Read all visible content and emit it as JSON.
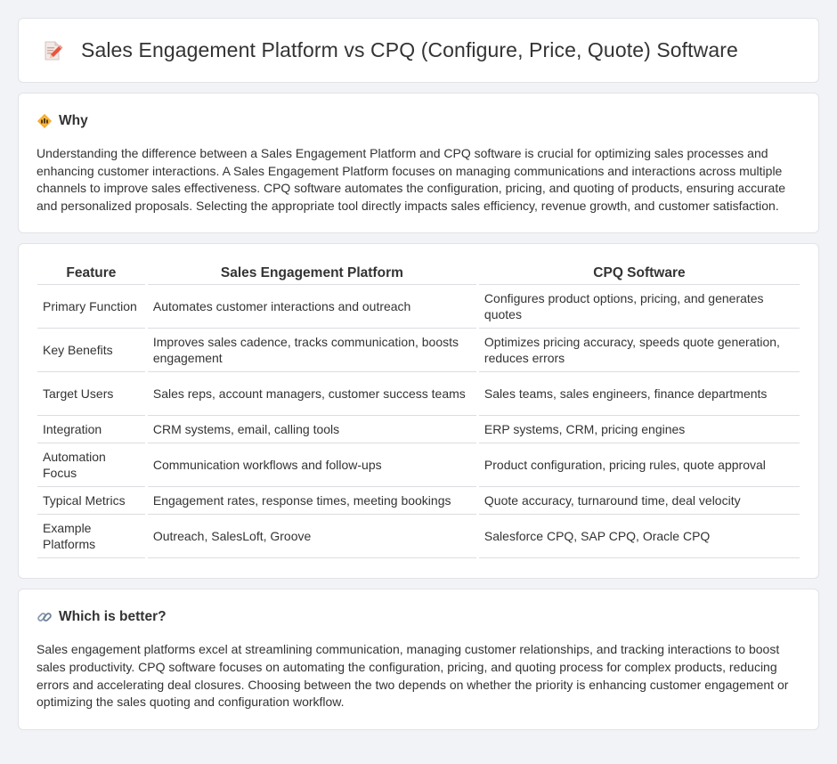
{
  "page": {
    "title": "Sales Engagement Platform vs CPQ (Configure, Price, Quote) Software"
  },
  "why": {
    "heading": "Why",
    "body": "Understanding the difference between a Sales Engagement Platform and CPQ software is crucial for optimizing sales processes and enhancing customer interactions. A Sales Engagement Platform focuses on managing communications and interactions across multiple channels to improve sales effectiveness. CPQ software automates the configuration, pricing, and quoting of products, ensuring accurate and personalized proposals. Selecting the appropriate tool directly impacts sales efficiency, revenue growth, and customer satisfaction."
  },
  "table": {
    "headers": [
      "Feature",
      "Sales Engagement Platform",
      "CPQ Software"
    ],
    "rows": [
      [
        "Primary Function",
        "Automates customer interactions and outreach",
        "Configures product options, pricing, and generates quotes"
      ],
      [
        "Key Benefits",
        "Improves sales cadence, tracks communication, boosts engagement",
        "Optimizes pricing accuracy, speeds quote generation, reduces errors"
      ],
      [
        "Target Users",
        "Sales reps, account managers, customer success teams",
        "Sales teams, sales engineers, finance departments"
      ],
      [
        "Integration",
        "CRM systems, email, calling tools",
        "ERP systems, CRM, pricing engines"
      ],
      [
        "Automation Focus",
        "Communication workflows and follow-ups",
        "Product configuration, pricing rules, quote approval"
      ],
      [
        "Typical Metrics",
        "Engagement rates, response times, meeting bookings",
        "Quote accuracy, turnaround time, deal velocity"
      ],
      [
        "Example Platforms",
        "Outreach, SalesLoft, Groove",
        "Salesforce CPQ, SAP CPQ, Oracle CPQ"
      ]
    ]
  },
  "better": {
    "heading": "Which is better?",
    "body": "Sales engagement platforms excel at streamlining communication, managing customer relationships, and tracking interactions to boost sales productivity. CPQ software focuses on automating the configuration, pricing, and quoting process for complex products, reducing errors and accelerating deal closures. Choosing between the two depends on whether the priority is enhancing customer engagement or optimizing the sales quoting and configuration workflow."
  },
  "icons": {
    "title": "document-pencil-icon",
    "why": "diamond-sign-icon",
    "better": "link-icon"
  },
  "colors": {
    "background": "#f2f3f6",
    "card": "#ffffff",
    "text": "#333333",
    "border": "#dcdde1"
  }
}
